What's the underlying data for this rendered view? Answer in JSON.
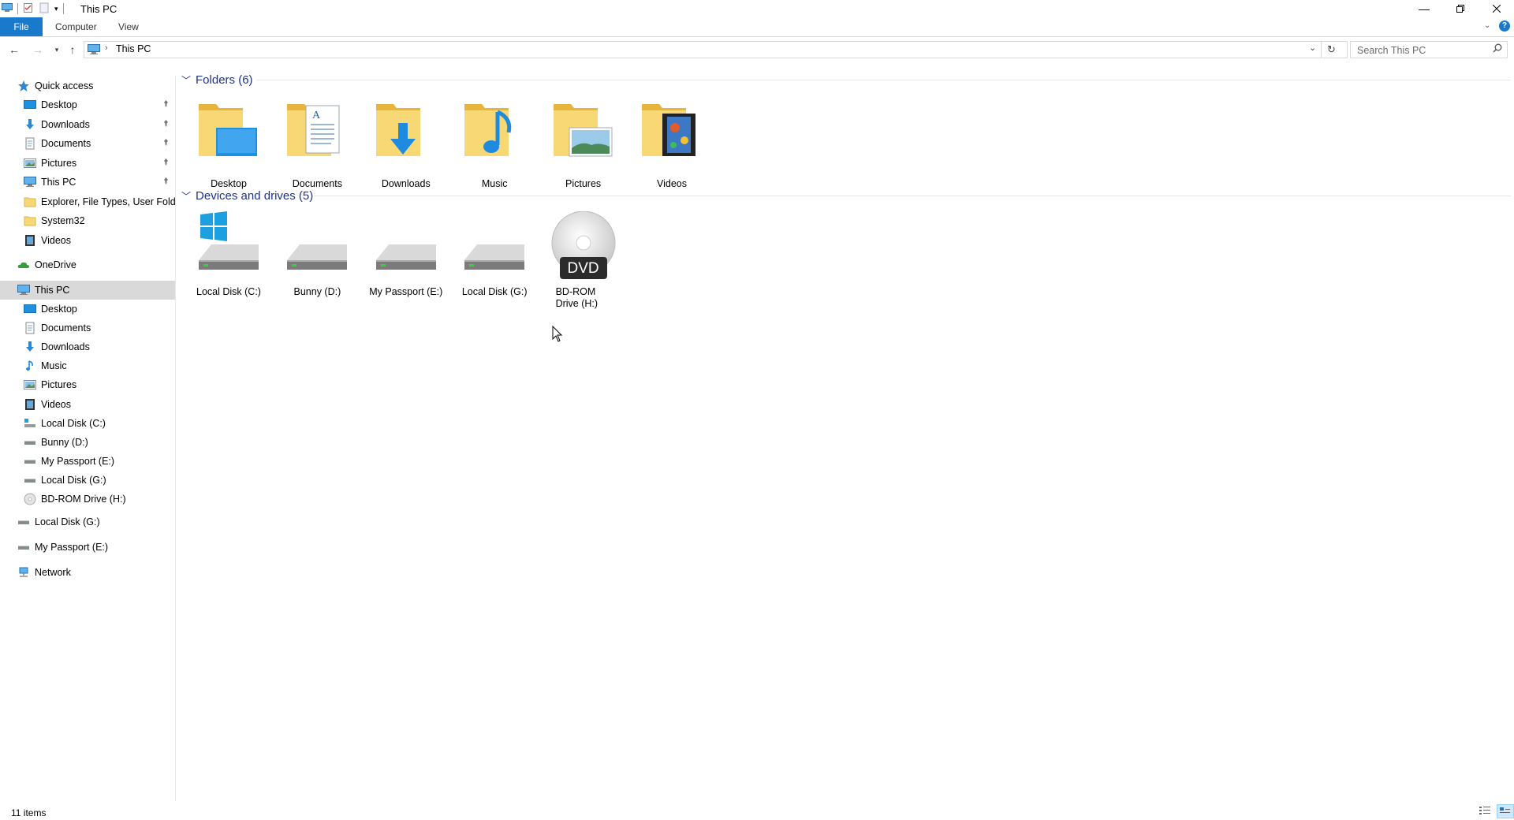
{
  "window": {
    "title": "This PC",
    "controls": [
      "minimize",
      "restore",
      "close"
    ]
  },
  "ribbon": {
    "tabs": [
      {
        "label": "File"
      },
      {
        "label": "Computer"
      },
      {
        "label": "View"
      }
    ]
  },
  "address": {
    "breadcrumb": "This PC"
  },
  "search": {
    "placeholder": "Search This PC"
  },
  "nav": {
    "quick_access": "Quick access",
    "quick_items": [
      {
        "label": "Desktop",
        "icon": "desktop-icon",
        "pinned": true
      },
      {
        "label": "Downloads",
        "icon": "downloads-icon",
        "pinned": true
      },
      {
        "label": "Documents",
        "icon": "documents-icon",
        "pinned": true
      },
      {
        "label": "Pictures",
        "icon": "pictures-icon",
        "pinned": true
      },
      {
        "label": "This PC",
        "icon": "computer-icon",
        "pinned": true
      },
      {
        "label": "Explorer, File Types, User Folders",
        "icon": "folder-icon",
        "pinned": false
      },
      {
        "label": "System32",
        "icon": "folder-icon",
        "pinned": false
      },
      {
        "label": "Videos",
        "icon": "videos-icon",
        "pinned": false
      }
    ],
    "onedrive": "OneDrive",
    "this_pc": "This PC",
    "pc_items": [
      {
        "label": "Desktop",
        "icon": "desktop-icon"
      },
      {
        "label": "Documents",
        "icon": "documents-icon"
      },
      {
        "label": "Downloads",
        "icon": "downloads-icon"
      },
      {
        "label": "Music",
        "icon": "music-icon"
      },
      {
        "label": "Pictures",
        "icon": "pictures-icon"
      },
      {
        "label": "Videos",
        "icon": "videos-icon"
      },
      {
        "label": "Local Disk (C:)",
        "icon": "system-drive-icon"
      },
      {
        "label": "Bunny (D:)",
        "icon": "drive-icon"
      },
      {
        "label": "My Passport (E:)",
        "icon": "drive-icon"
      },
      {
        "label": "Local Disk (G:)",
        "icon": "drive-icon"
      },
      {
        "label": "BD-ROM Drive (H:)",
        "icon": "disc-icon"
      }
    ],
    "extra_drives": [
      "Local Disk (G:)",
      "My Passport (E:)"
    ],
    "network": "Network"
  },
  "content": {
    "folders_header": "Folders (6)",
    "folders": [
      {
        "label": "Desktop",
        "icon": "desktop-folder-icon"
      },
      {
        "label": "Documents",
        "icon": "documents-folder-icon"
      },
      {
        "label": "Downloads",
        "icon": "downloads-folder-icon"
      },
      {
        "label": "Music",
        "icon": "music-folder-icon"
      },
      {
        "label": "Pictures",
        "icon": "pictures-folder-icon"
      },
      {
        "label": "Videos",
        "icon": "videos-folder-icon"
      }
    ],
    "drives_header": "Devices and drives (5)",
    "drives": [
      {
        "label": "Local Disk (C:)",
        "icon": "system-drive-icon"
      },
      {
        "label": "Bunny (D:)",
        "icon": "drive-icon"
      },
      {
        "label": "My Passport (E:)",
        "icon": "drive-icon"
      },
      {
        "label": "Local Disk (G:)",
        "icon": "drive-icon"
      },
      {
        "label": "BD-ROM Drive (H:)",
        "icon": "dvd-drive-icon",
        "badge": "DVD"
      }
    ]
  },
  "status": {
    "items": "11 items"
  },
  "colors": {
    "accent": "#1979ca",
    "group_header": "#1e3287",
    "folder": "#f8d775",
    "selection": "#d9d9d9"
  }
}
